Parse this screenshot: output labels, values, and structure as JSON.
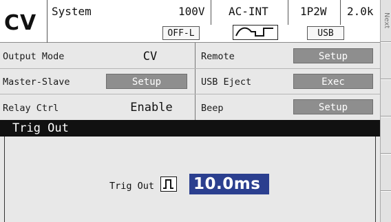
{
  "header": {
    "mode": "CV",
    "system_label": "System",
    "voltage_range": "100V",
    "source": "AC-INT",
    "wiring": "1P2W",
    "frequency": "2.0k",
    "output_state": "OFF-L",
    "waveform_icon": "ac-wave-icon",
    "interface": "USB"
  },
  "side_bar": {
    "next_label": "Next"
  },
  "settings": {
    "left": [
      {
        "label": "Output Mode",
        "value": "CV"
      },
      {
        "label": "Master-Slave",
        "button": "Setup"
      },
      {
        "label": "Relay Ctrl",
        "value": "Enable"
      }
    ],
    "right": [
      {
        "label": "Remote",
        "button": "Setup"
      },
      {
        "label": "USB Eject",
        "button": "Exec"
      },
      {
        "label": "Beep",
        "button": "Setup"
      }
    ]
  },
  "trig_panel": {
    "title": "Trig Out",
    "field_label": "Trig Out",
    "pulse_icon": "pulse-icon",
    "value": "10.0ms"
  },
  "colors": {
    "button_bg": "#8e8e8e",
    "selection_bg": "#2b3f8f",
    "title_bar_bg": "#111111",
    "panel_bg": "#e8e8e8"
  }
}
